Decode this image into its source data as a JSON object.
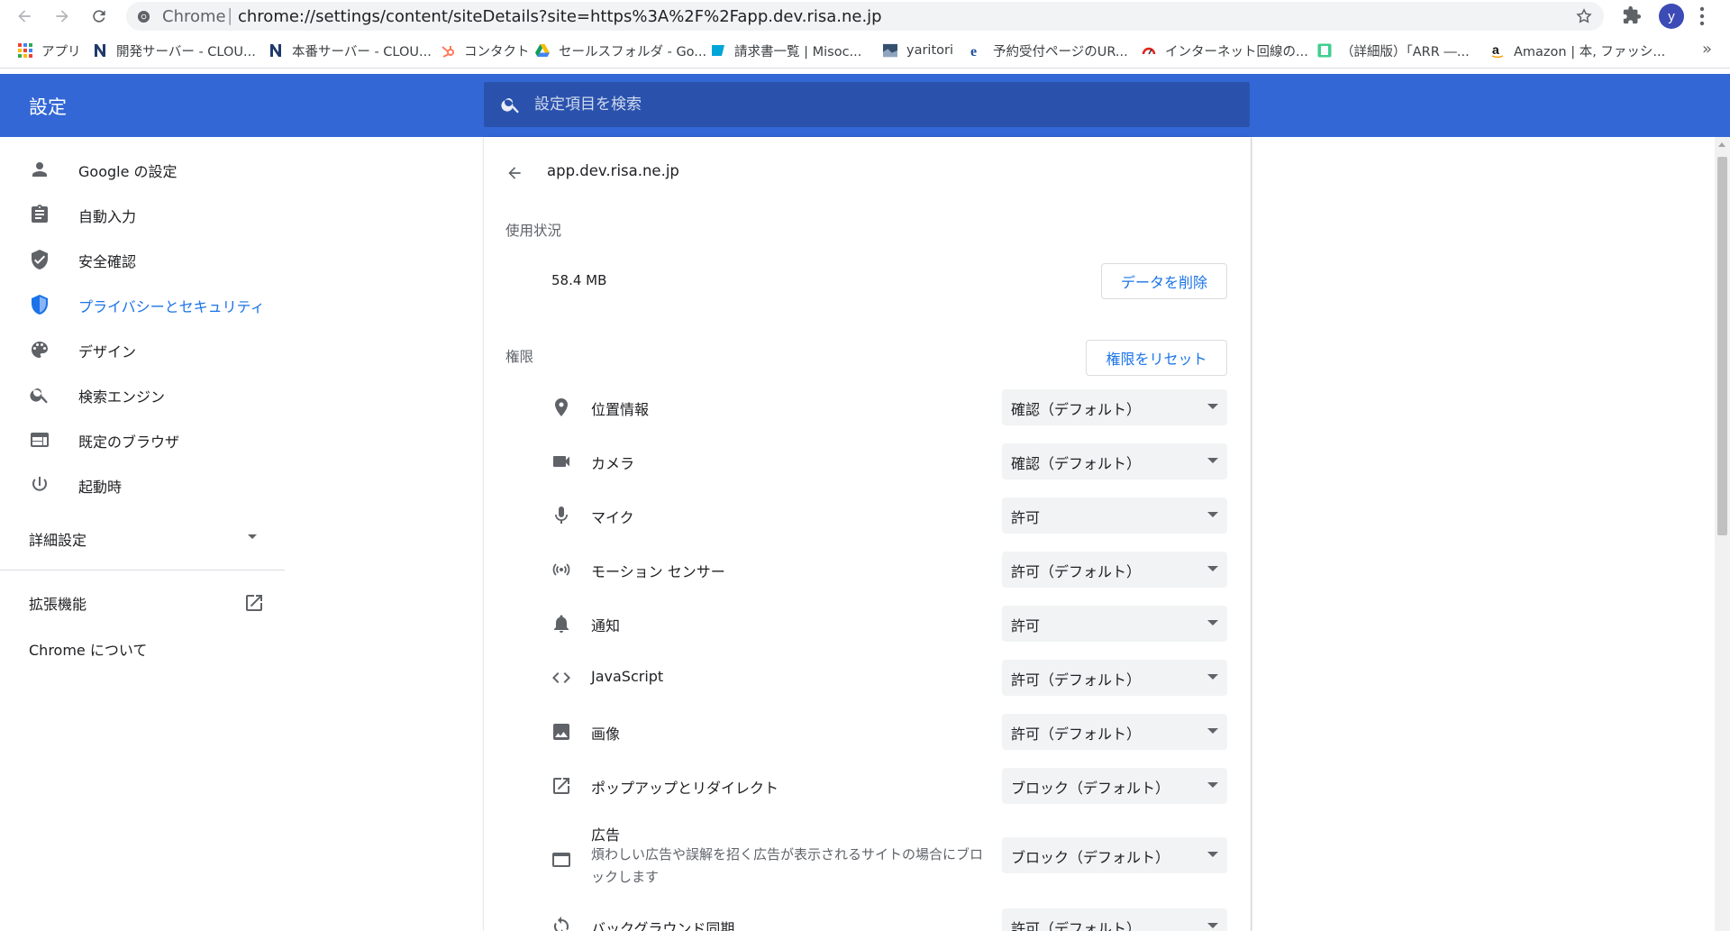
{
  "browser": {
    "omnibox_prefix": "Chrome",
    "omnibox_separator": "|",
    "url": "chrome://settings/content/siteDetails?site=https%3A%2F%2Fapp.dev.risa.ne.jp",
    "avatar_letter": "y",
    "bookmarks": [
      {
        "label": "アプリ",
        "icon": "apps-grid-icon"
      },
      {
        "label": "開発サーバー - CLOU...",
        "icon": "n-logo-icon"
      },
      {
        "label": "本番サーバー - CLOU...",
        "icon": "n-logo-icon"
      },
      {
        "label": "コンタクト",
        "icon": "hubspot-icon"
      },
      {
        "label": "セールスフォルダ - Go...",
        "icon": "google-drive-icon"
      },
      {
        "label": "請求書一覧 | Misoc...",
        "icon": "misoca-icon"
      },
      {
        "label": "yaritori",
        "icon": "yaritori-icon"
      },
      {
        "label": "予約受付ページのUR...",
        "icon": "ie-icon"
      },
      {
        "label": "インターネット回線の...",
        "icon": "speedometer-icon"
      },
      {
        "label": "（詳細版）「ARR ―...",
        "icon": "bookmark-square-icon"
      },
      {
        "label": "Amazon | 本, ファッシ...",
        "icon": "amazon-icon"
      }
    ],
    "bookmarks_overflow": "»"
  },
  "settings": {
    "title": "設定",
    "search_placeholder": "設定項目を検索"
  },
  "sidebar": {
    "items": [
      {
        "label": "Google の設定",
        "icon": "person-icon",
        "active": false
      },
      {
        "label": "自動入力",
        "icon": "clipboard-icon",
        "active": false
      },
      {
        "label": "安全確認",
        "icon": "shield-check-icon",
        "active": false
      },
      {
        "label": "プライバシーとセキュリティ",
        "icon": "shield-icon",
        "active": true
      },
      {
        "label": "デザイン",
        "icon": "palette-icon",
        "active": false
      },
      {
        "label": "検索エンジン",
        "icon": "search-icon",
        "active": false
      },
      {
        "label": "既定のブラウザ",
        "icon": "browser-icon",
        "active": false
      },
      {
        "label": "起動時",
        "icon": "power-icon",
        "active": false
      }
    ],
    "advanced": "詳細設定",
    "extensions": "拡張機能",
    "about": "Chrome について"
  },
  "site_details": {
    "origin": "app.dev.risa.ne.jp",
    "usage_title": "使用状況",
    "usage_size": "58.4 MB",
    "clear_data_label": "データを削除",
    "permissions_title": "権限",
    "reset_permissions_label": "権限をリセット",
    "permissions": [
      {
        "label": "位置情報",
        "value": "確認（デフォルト）",
        "icon": "location-pin-icon"
      },
      {
        "label": "カメラ",
        "value": "確認（デフォルト）",
        "icon": "camera-icon"
      },
      {
        "label": "マイク",
        "value": "許可",
        "icon": "microphone-icon"
      },
      {
        "label": "モーション センサー",
        "value": "許可（デフォルト）",
        "icon": "sensors-icon"
      },
      {
        "label": "通知",
        "value": "許可",
        "icon": "bell-icon"
      },
      {
        "label": "JavaScript",
        "value": "許可（デフォルト）",
        "icon": "code-icon"
      },
      {
        "label": "画像",
        "value": "許可（デフォルト）",
        "icon": "image-icon"
      },
      {
        "label": "ポップアップとリダイレクト",
        "value": "ブロック（デフォルト）",
        "icon": "open-in-new-icon"
      },
      {
        "label": "広告",
        "sublabel": "煩わしい広告や誤解を招く広告が表示されるサイトの場合にブロックします",
        "value": "ブロック（デフォルト）",
        "icon": "ads-window-icon"
      },
      {
        "label": "バックグラウンド同期",
        "value": "許可（デフォルト）",
        "icon": "sync-icon"
      }
    ]
  },
  "colors": {
    "header_blue": "#3367d6",
    "search_blue": "#2a52ad",
    "accent": "#1a73e8"
  }
}
